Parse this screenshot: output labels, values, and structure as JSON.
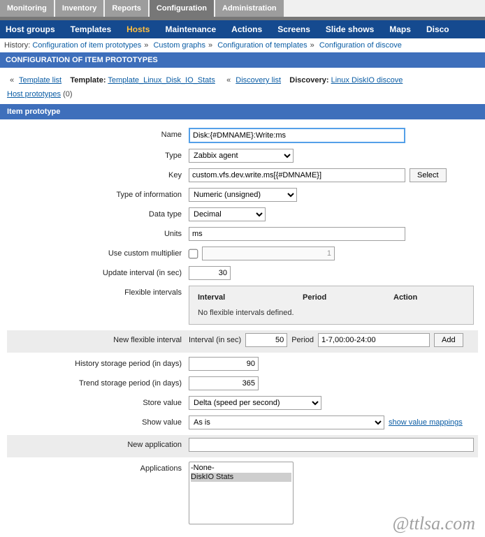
{
  "topTabs": {
    "monitoring": "Monitoring",
    "inventory": "Inventory",
    "reports": "Reports",
    "configuration": "Configuration",
    "administration": "Administration"
  },
  "subNav": {
    "hostGroups": "Host groups",
    "templates": "Templates",
    "hosts": "Hosts",
    "maintenance": "Maintenance",
    "actions": "Actions",
    "screens": "Screens",
    "slideShows": "Slide shows",
    "maps": "Maps",
    "disco": "Disco"
  },
  "history": {
    "label": "History:",
    "i1": "Configuration of item prototypes",
    "i2": "Custom graphs",
    "i3": "Configuration of templates",
    "i4": "Configuration of discove"
  },
  "headerBar": "CONFIGURATION OF ITEM PROTOTYPES",
  "crumb": {
    "templateList": "Template list",
    "templateLabel": "Template:",
    "templateName": "Template_Linux_Disk_IO_Stats",
    "discoveryList": "Discovery list",
    "discoveryLabel": "Discovery:",
    "discoveryName": "Linux DiskIO discove"
  },
  "hostProto": {
    "link": "Host prototypes",
    "count": "(0)"
  },
  "section": "Item prototype",
  "labels": {
    "name": "Name",
    "type": "Type",
    "key": "Key",
    "toi": "Type of information",
    "dtype": "Data type",
    "units": "Units",
    "mult": "Use custom multiplier",
    "updint": "Update interval (in sec)",
    "flexint": "Flexible intervals",
    "newflex": "New flexible interval",
    "hist": "History storage period (in days)",
    "trend": "Trend storage period (in days)",
    "store": "Store value",
    "show": "Show value",
    "newapp": "New application",
    "apps": "Applications"
  },
  "values": {
    "name": "Disk:{#DMNAME}:Write:ms",
    "type": "Zabbix agent",
    "key": "custom.vfs.dev.write.ms[{#DMNAME}]",
    "toi": "Numeric (unsigned)",
    "dtype": "Decimal",
    "units": "ms",
    "mult": "1",
    "updint": "30",
    "hist": "90",
    "trend": "365",
    "store": "Delta (speed per second)",
    "show": "As is",
    "newapp": "",
    "apps": {
      "none": "-None-",
      "disk": "DiskIO Stats"
    },
    "newflex": {
      "intlabel": "Interval (in sec)",
      "int": "50",
      "perlabel": "Period",
      "per": "1-7,00:00-24:00"
    }
  },
  "flexbox": {
    "hInterval": "Interval",
    "hPeriod": "Period",
    "hAction": "Action",
    "empty": "No flexible intervals defined."
  },
  "buttons": {
    "select": "Select",
    "add": "Add"
  },
  "links": {
    "showValueMap": "show value mappings"
  },
  "watermark": "@ttlsa.com"
}
